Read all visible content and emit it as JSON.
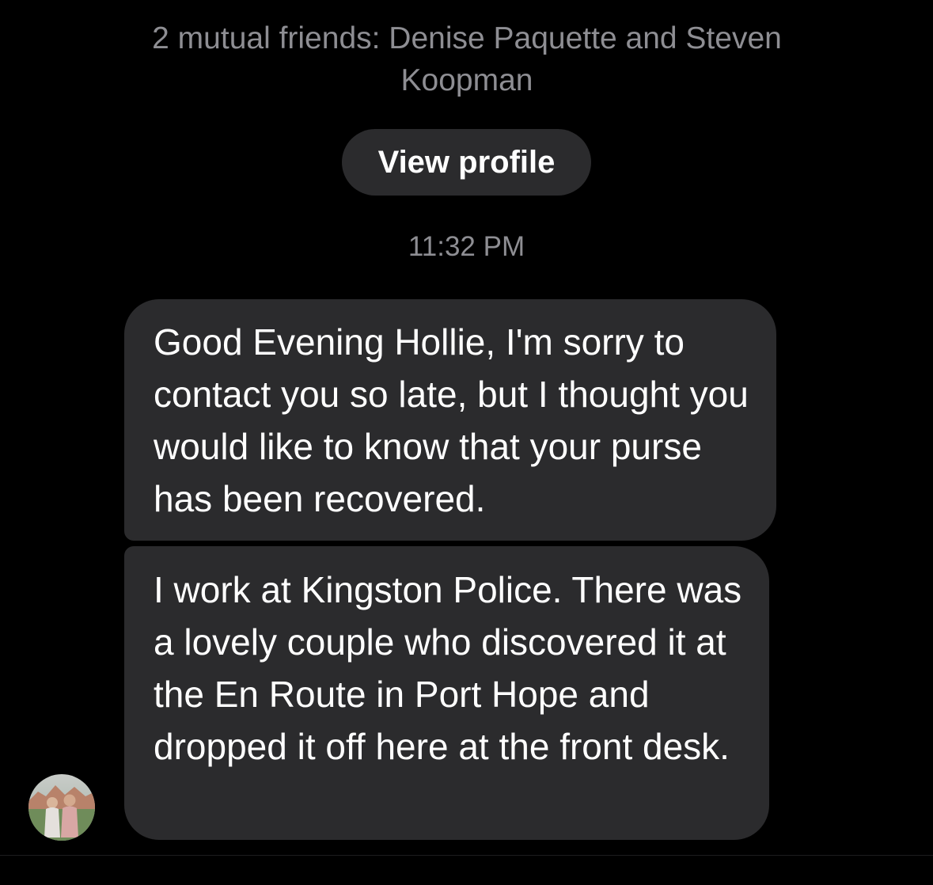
{
  "header": {
    "mutual_friends": "2 mutual friends: Denise Paquette and Steven Koopman",
    "view_profile_label": "View profile"
  },
  "conversation": {
    "timestamp": "11:32 PM",
    "messages": [
      {
        "text": "Good Evening Hollie, I'm sorry to contact you so late, but I thought you would like to know that your purse has been recovered."
      },
      {
        "text": "I work at Kingston Police.  There was a lovely couple who discovered it at the En Route in Port Hope and dropped it off here at the front desk."
      }
    ]
  },
  "colors": {
    "background": "#000000",
    "bubble": "#2b2b2d",
    "secondary_text": "#8e8e93",
    "primary_text": "#ffffff"
  }
}
